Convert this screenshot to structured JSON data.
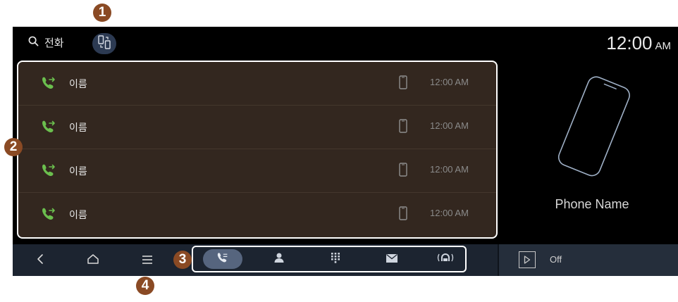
{
  "callouts": [
    "1",
    "2",
    "3",
    "4"
  ],
  "header": {
    "title": "전화",
    "clock_time": "12:00",
    "clock_ampm": "AM"
  },
  "call_log": [
    {
      "name": "이름",
      "time": "12:00 AM",
      "icon": "outgoing-call-icon",
      "device": "mobile-phone-icon"
    },
    {
      "name": "이름",
      "time": "12:00 AM",
      "icon": "outgoing-call-icon",
      "device": "mobile-phone-icon"
    },
    {
      "name": "이름",
      "time": "12:00 AM",
      "icon": "outgoing-call-icon",
      "device": "mobile-phone-icon"
    },
    {
      "name": "이름",
      "time": "12:00 AM",
      "icon": "outgoing-call-icon",
      "device": "mobile-phone-icon"
    }
  ],
  "phone": {
    "name": "Phone Name"
  },
  "navigation": [
    "back-icon",
    "home-icon",
    "menu-icon"
  ],
  "tabs": [
    {
      "name": "call-history-tab",
      "icon": "call-history-icon",
      "active": true
    },
    {
      "name": "contacts-tab",
      "icon": "person-icon",
      "active": false
    },
    {
      "name": "keypad-tab",
      "icon": "keypad-icon",
      "active": false
    },
    {
      "name": "messages-tab",
      "icon": "envelope-icon",
      "active": false
    },
    {
      "name": "carplay-tab",
      "icon": "wireless-projection-icon",
      "active": false
    }
  ],
  "media": {
    "state": "Off"
  },
  "colors": {
    "accent_green": "#6bbf4e",
    "callout": "#8a4a24",
    "list_bg": "#33271f",
    "active_tab": "#56657e"
  }
}
